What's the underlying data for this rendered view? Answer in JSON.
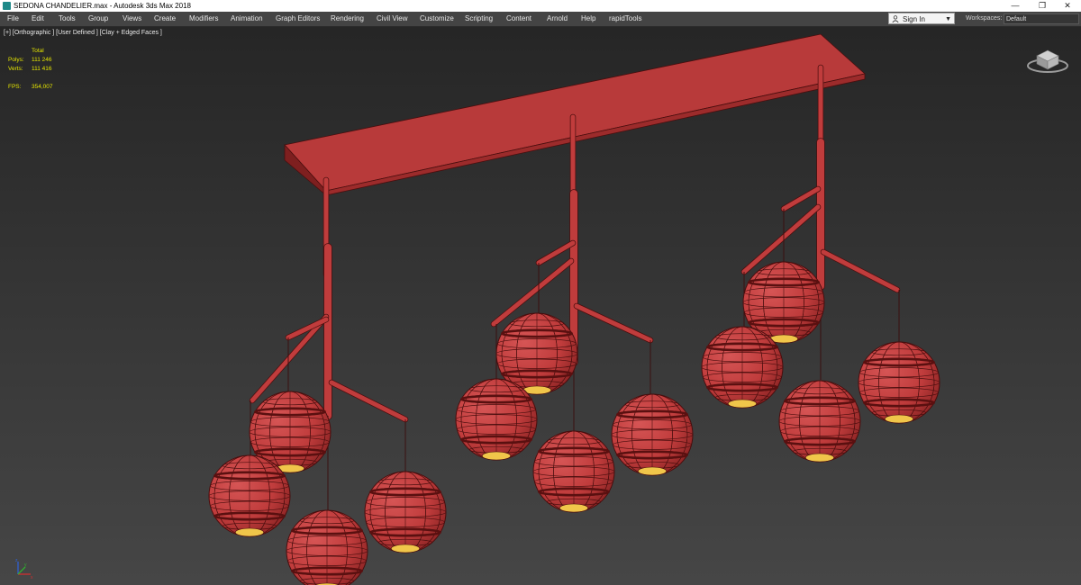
{
  "window": {
    "title": "SEDONA CHANDELIER.max - Autodesk 3ds Max 2018",
    "buttons": {
      "minimize": "—",
      "restore": "❐",
      "close": "✕"
    }
  },
  "menubar": {
    "items": [
      "File",
      "Edit",
      "Tools",
      "Group",
      "Views",
      "Create",
      "Modifiers",
      "Animation",
      "Graph Editors",
      "Rendering",
      "Civil View",
      "Customize",
      "Scripting",
      "Content",
      "Arnold",
      "Help",
      "rapidTools"
    ],
    "sign_in": "Sign In",
    "workspaces_label": "Workspaces:",
    "workspaces_value": "Default"
  },
  "viewport": {
    "label": "[+] [Orthographic ] [User Defined ] [Clay + Edged Faces ]",
    "stats": {
      "header": "Total",
      "polys_label": "Polys:",
      "polys_value": "111 246",
      "verts_label": "Verts:",
      "verts_value": "111 416",
      "fps_label": "FPS:",
      "fps_value": "354,007"
    },
    "axis_labels": {
      "x": "x",
      "y": "y",
      "z": "z"
    }
  },
  "colors": {
    "model": "#c03c3c",
    "model_dark": "#8a2323",
    "wire": "#4a0e0e",
    "stats_text": "#e5e500",
    "viewport_top": "#262626",
    "viewport_bottom": "#464646"
  }
}
